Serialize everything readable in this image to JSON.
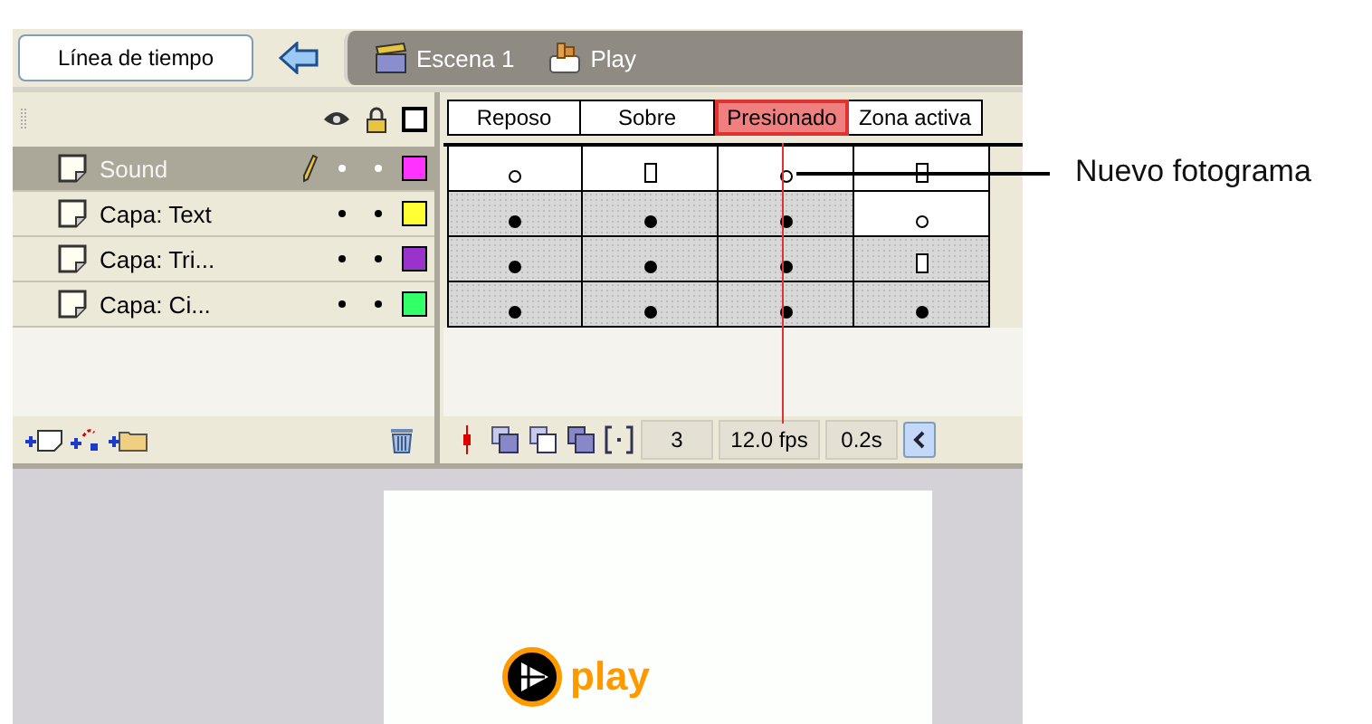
{
  "toolbar": {
    "timeline_button": "Línea de tiempo",
    "breadcrumbs": [
      {
        "kind": "scene",
        "label": "Escena 1"
      },
      {
        "kind": "symbol",
        "label": "Play"
      }
    ]
  },
  "frame_headers": [
    {
      "label": "Reposo",
      "selected": false
    },
    {
      "label": "Sobre",
      "selected": false
    },
    {
      "label": "Presionado",
      "selected": true
    },
    {
      "label": "Zona activa",
      "selected": false
    }
  ],
  "layers": [
    {
      "name": "Sound",
      "selected": true,
      "editing": true,
      "color": "#ff33ff",
      "frames": [
        {
          "kind": "empty_keyframe",
          "filled": false
        },
        {
          "kind": "end_frame",
          "filled": false
        },
        {
          "kind": "empty_keyframe",
          "filled": false
        },
        {
          "kind": "end_frame",
          "filled": false
        }
      ]
    },
    {
      "name": "Capa: Text",
      "selected": false,
      "editing": false,
      "color": "#ffff33",
      "frames": [
        {
          "kind": "keyframe",
          "filled": true
        },
        {
          "kind": "keyframe",
          "filled": true
        },
        {
          "kind": "keyframe",
          "filled": true
        },
        {
          "kind": "empty_keyframe",
          "filled": false
        }
      ]
    },
    {
      "name": "Capa: Tri...",
      "selected": false,
      "editing": false,
      "color": "#9933cc",
      "frames": [
        {
          "kind": "keyframe",
          "filled": true
        },
        {
          "kind": "keyframe",
          "filled": true
        },
        {
          "kind": "keyframe",
          "filled": true
        },
        {
          "kind": "end_frame",
          "filled": true
        }
      ]
    },
    {
      "name": "Capa: Ci...",
      "selected": false,
      "editing": false,
      "color": "#33ff66",
      "frames": [
        {
          "kind": "keyframe",
          "filled": true
        },
        {
          "kind": "keyframe",
          "filled": true
        },
        {
          "kind": "keyframe",
          "filled": true
        },
        {
          "kind": "keyframe",
          "filled": true
        }
      ]
    }
  ],
  "status": {
    "current_frame": "3",
    "frame_rate": "12.0 fps",
    "elapsed_time": "0.2s"
  },
  "stage": {
    "button_label": "play"
  },
  "callout": "Nuevo fotograma"
}
